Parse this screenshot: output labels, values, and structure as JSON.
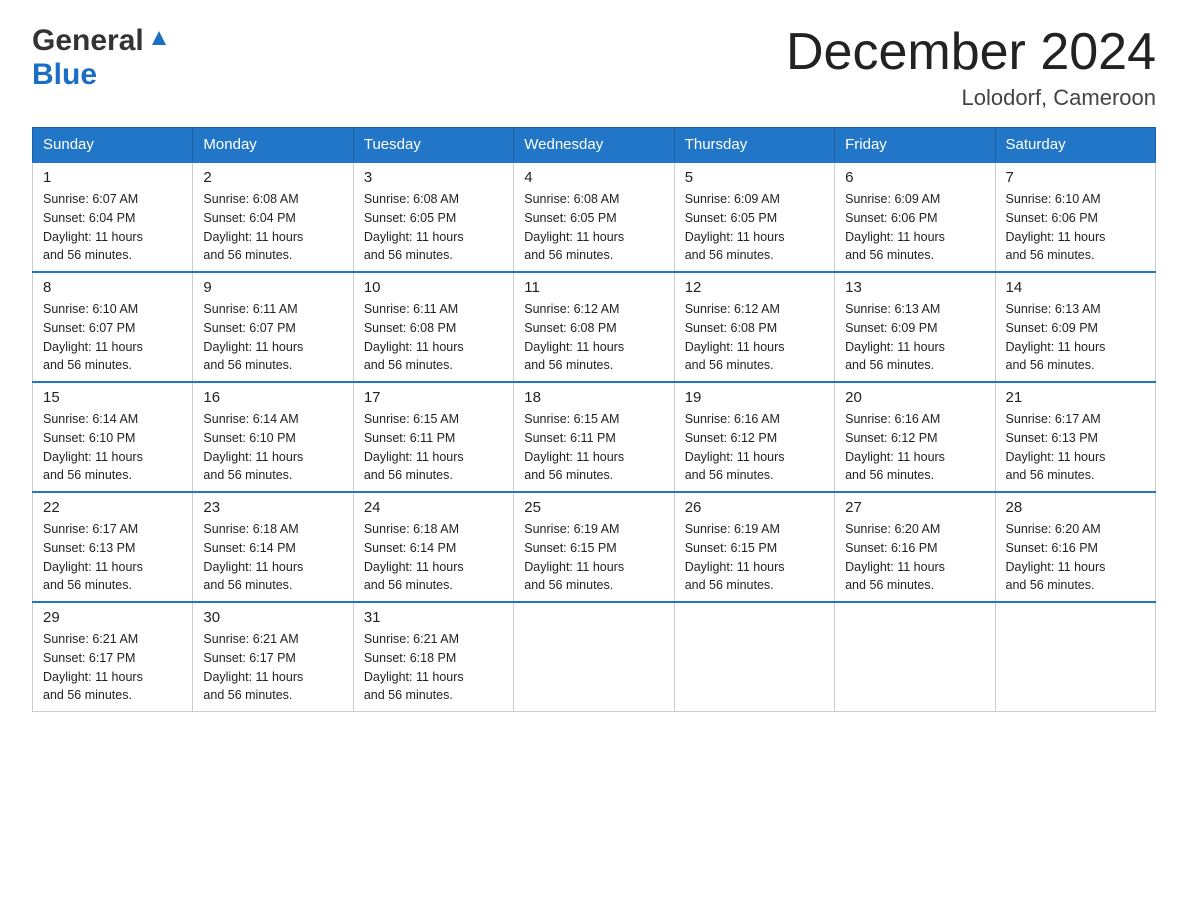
{
  "header": {
    "logo_general": "General",
    "logo_blue": "Blue",
    "month_title": "December 2024",
    "location": "Lolodorf, Cameroon"
  },
  "days_of_week": [
    "Sunday",
    "Monday",
    "Tuesday",
    "Wednesday",
    "Thursday",
    "Friday",
    "Saturday"
  ],
  "weeks": [
    [
      {
        "day": "1",
        "sunrise": "6:07 AM",
        "sunset": "6:04 PM",
        "daylight": "11 hours and 56 minutes."
      },
      {
        "day": "2",
        "sunrise": "6:08 AM",
        "sunset": "6:04 PM",
        "daylight": "11 hours and 56 minutes."
      },
      {
        "day": "3",
        "sunrise": "6:08 AM",
        "sunset": "6:05 PM",
        "daylight": "11 hours and 56 minutes."
      },
      {
        "day": "4",
        "sunrise": "6:08 AM",
        "sunset": "6:05 PM",
        "daylight": "11 hours and 56 minutes."
      },
      {
        "day": "5",
        "sunrise": "6:09 AM",
        "sunset": "6:05 PM",
        "daylight": "11 hours and 56 minutes."
      },
      {
        "day": "6",
        "sunrise": "6:09 AM",
        "sunset": "6:06 PM",
        "daylight": "11 hours and 56 minutes."
      },
      {
        "day": "7",
        "sunrise": "6:10 AM",
        "sunset": "6:06 PM",
        "daylight": "11 hours and 56 minutes."
      }
    ],
    [
      {
        "day": "8",
        "sunrise": "6:10 AM",
        "sunset": "6:07 PM",
        "daylight": "11 hours and 56 minutes."
      },
      {
        "day": "9",
        "sunrise": "6:11 AM",
        "sunset": "6:07 PM",
        "daylight": "11 hours and 56 minutes."
      },
      {
        "day": "10",
        "sunrise": "6:11 AM",
        "sunset": "6:08 PM",
        "daylight": "11 hours and 56 minutes."
      },
      {
        "day": "11",
        "sunrise": "6:12 AM",
        "sunset": "6:08 PM",
        "daylight": "11 hours and 56 minutes."
      },
      {
        "day": "12",
        "sunrise": "6:12 AM",
        "sunset": "6:08 PM",
        "daylight": "11 hours and 56 minutes."
      },
      {
        "day": "13",
        "sunrise": "6:13 AM",
        "sunset": "6:09 PM",
        "daylight": "11 hours and 56 minutes."
      },
      {
        "day": "14",
        "sunrise": "6:13 AM",
        "sunset": "6:09 PM",
        "daylight": "11 hours and 56 minutes."
      }
    ],
    [
      {
        "day": "15",
        "sunrise": "6:14 AM",
        "sunset": "6:10 PM",
        "daylight": "11 hours and 56 minutes."
      },
      {
        "day": "16",
        "sunrise": "6:14 AM",
        "sunset": "6:10 PM",
        "daylight": "11 hours and 56 minutes."
      },
      {
        "day": "17",
        "sunrise": "6:15 AM",
        "sunset": "6:11 PM",
        "daylight": "11 hours and 56 minutes."
      },
      {
        "day": "18",
        "sunrise": "6:15 AM",
        "sunset": "6:11 PM",
        "daylight": "11 hours and 56 minutes."
      },
      {
        "day": "19",
        "sunrise": "6:16 AM",
        "sunset": "6:12 PM",
        "daylight": "11 hours and 56 minutes."
      },
      {
        "day": "20",
        "sunrise": "6:16 AM",
        "sunset": "6:12 PM",
        "daylight": "11 hours and 56 minutes."
      },
      {
        "day": "21",
        "sunrise": "6:17 AM",
        "sunset": "6:13 PM",
        "daylight": "11 hours and 56 minutes."
      }
    ],
    [
      {
        "day": "22",
        "sunrise": "6:17 AM",
        "sunset": "6:13 PM",
        "daylight": "11 hours and 56 minutes."
      },
      {
        "day": "23",
        "sunrise": "6:18 AM",
        "sunset": "6:14 PM",
        "daylight": "11 hours and 56 minutes."
      },
      {
        "day": "24",
        "sunrise": "6:18 AM",
        "sunset": "6:14 PM",
        "daylight": "11 hours and 56 minutes."
      },
      {
        "day": "25",
        "sunrise": "6:19 AM",
        "sunset": "6:15 PM",
        "daylight": "11 hours and 56 minutes."
      },
      {
        "day": "26",
        "sunrise": "6:19 AM",
        "sunset": "6:15 PM",
        "daylight": "11 hours and 56 minutes."
      },
      {
        "day": "27",
        "sunrise": "6:20 AM",
        "sunset": "6:16 PM",
        "daylight": "11 hours and 56 minutes."
      },
      {
        "day": "28",
        "sunrise": "6:20 AM",
        "sunset": "6:16 PM",
        "daylight": "11 hours and 56 minutes."
      }
    ],
    [
      {
        "day": "29",
        "sunrise": "6:21 AM",
        "sunset": "6:17 PM",
        "daylight": "11 hours and 56 minutes."
      },
      {
        "day": "30",
        "sunrise": "6:21 AM",
        "sunset": "6:17 PM",
        "daylight": "11 hours and 56 minutes."
      },
      {
        "day": "31",
        "sunrise": "6:21 AM",
        "sunset": "6:18 PM",
        "daylight": "11 hours and 56 minutes."
      },
      null,
      null,
      null,
      null
    ]
  ],
  "labels": {
    "sunrise": "Sunrise:",
    "sunset": "Sunset:",
    "daylight": "Daylight:"
  }
}
